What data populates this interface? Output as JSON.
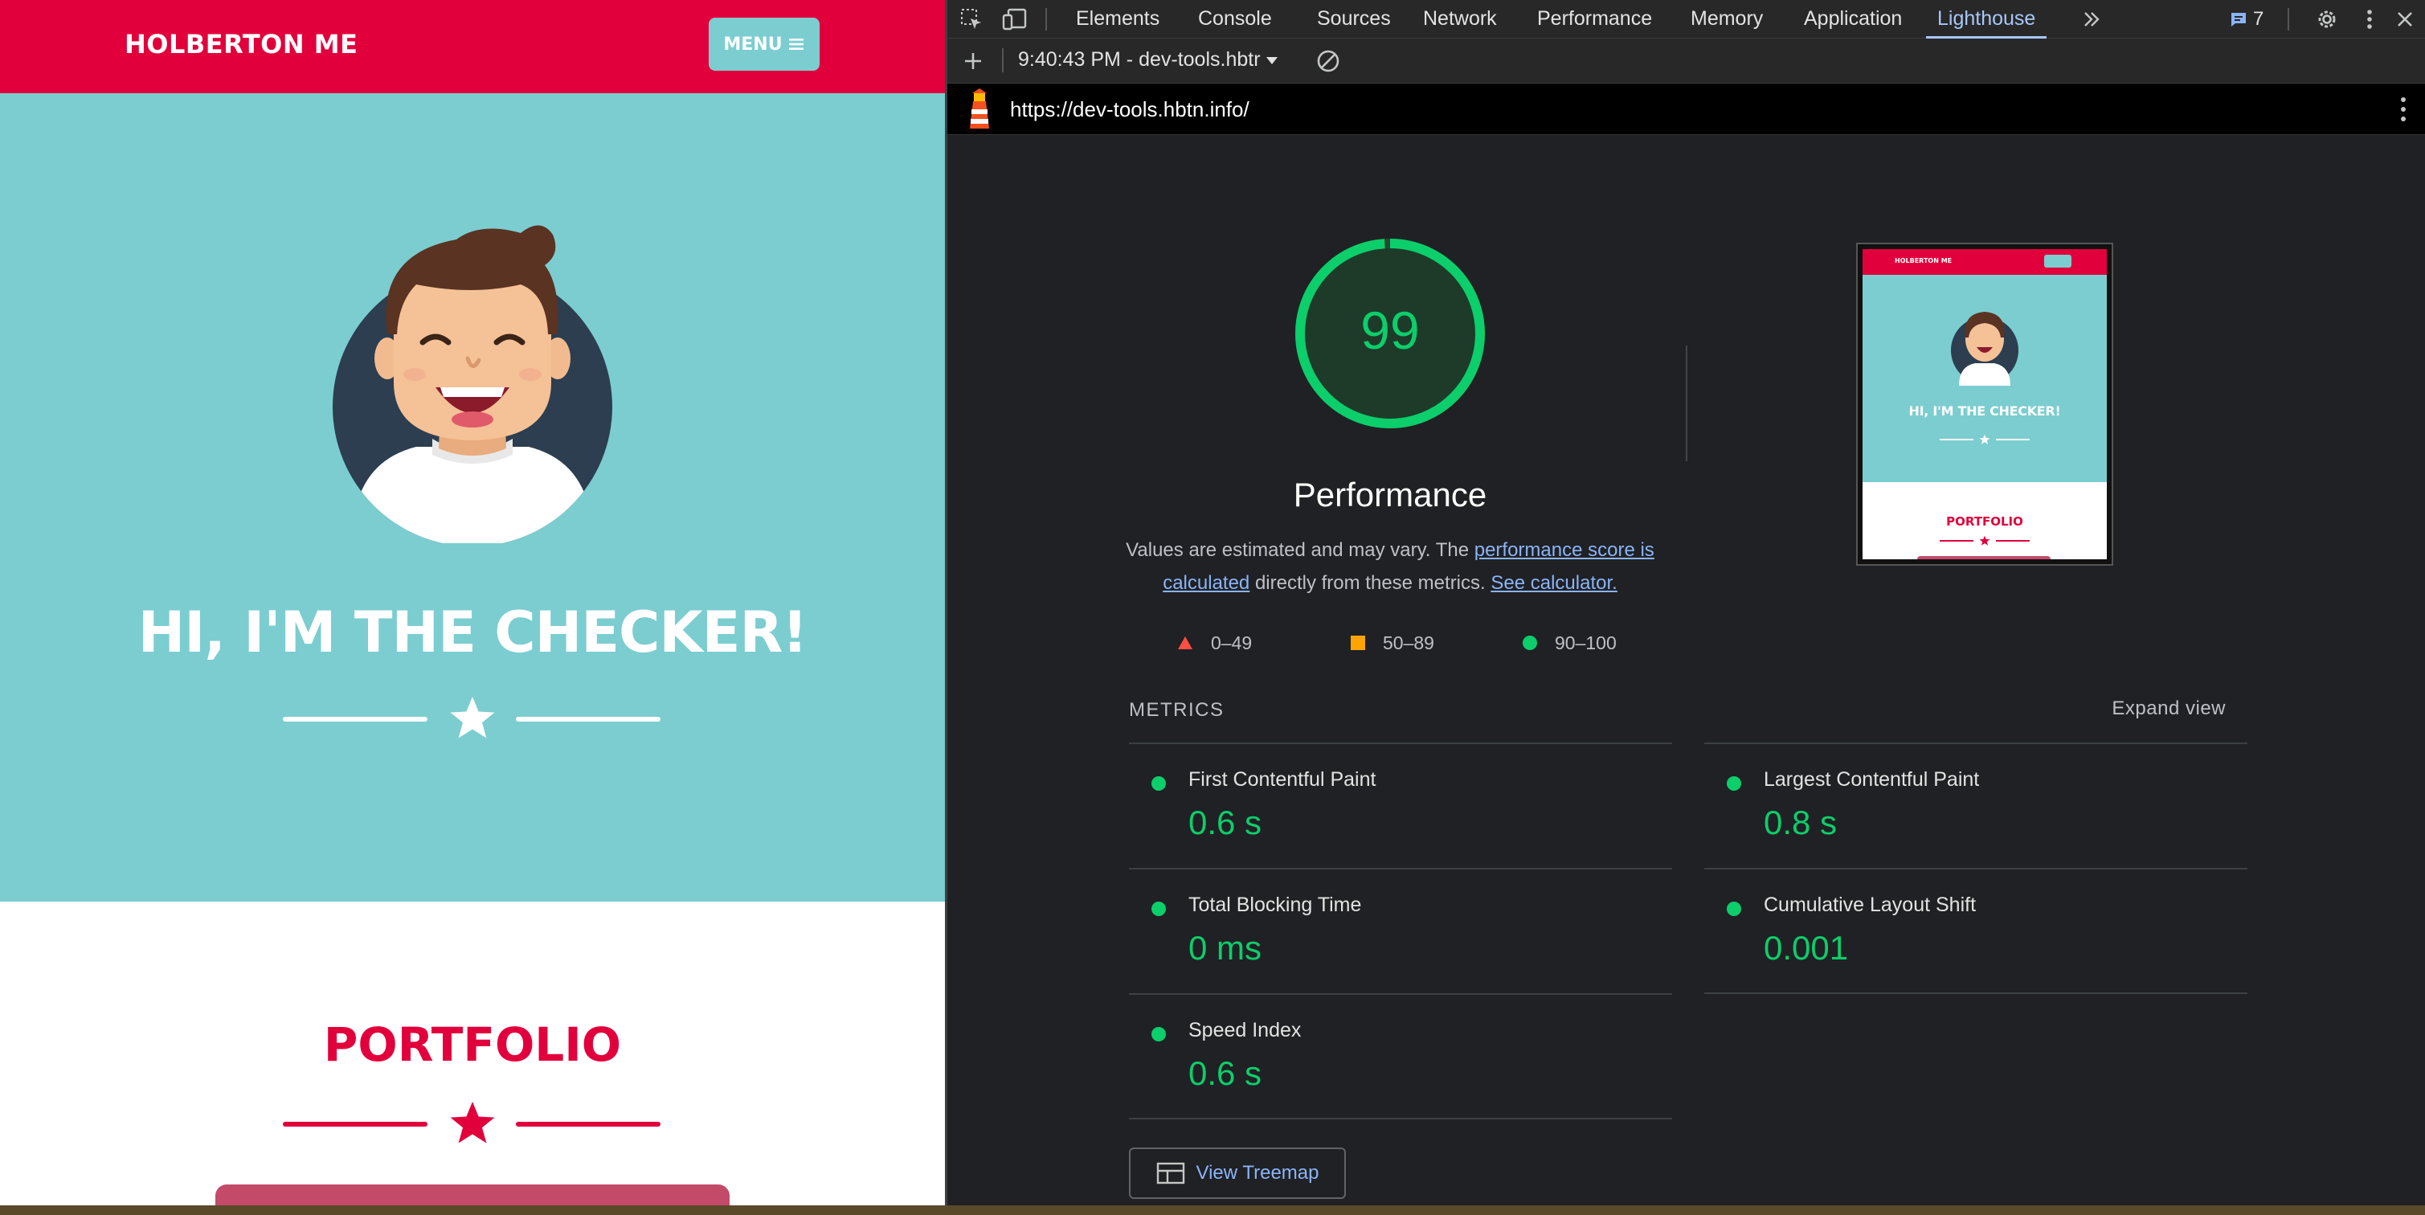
{
  "site": {
    "brand": "HOLBERTON ME",
    "menu_label": "MENU",
    "hero_title": "HI, I'M THE CHECKER!",
    "portfolio_title": "PORTFOLIO",
    "colors": {
      "primary": "#e1003c",
      "hero_bg": "#7bcdd0"
    }
  },
  "devtools": {
    "tabs": [
      {
        "label": "Elements"
      },
      {
        "label": "Console"
      },
      {
        "label": "Sources"
      },
      {
        "label": "Network"
      },
      {
        "label": "Performance"
      },
      {
        "label": "Memory"
      },
      {
        "label": "Application"
      },
      {
        "label": "Lighthouse",
        "active": true
      }
    ],
    "issues_count": "7",
    "toolbar": {
      "report_label": "9:40:43 PM - dev-tools.hbtr"
    },
    "url": "https://dev-tools.hbtn.info/"
  },
  "report": {
    "score": "99",
    "score_fraction": 0.99,
    "category": "Performance",
    "desc_prefix": "Values are estimated and may vary. The ",
    "desc_link1": "performance score is calculated",
    "desc_mid": " directly from these metrics. ",
    "desc_link2": "See calculator.",
    "legend": [
      {
        "range": "0–49",
        "shape": "triangle",
        "color": "#ff4e42"
      },
      {
        "range": "50–89",
        "shape": "square",
        "color": "#ffa400"
      },
      {
        "range": "90–100",
        "shape": "circle",
        "color": "#0cce6b"
      }
    ],
    "metrics_title": "METRICS",
    "expand_label": "Expand view",
    "metrics": [
      {
        "name": "First Contentful Paint",
        "value": "0.6 s"
      },
      {
        "name": "Largest Contentful Paint",
        "value": "0.8 s"
      },
      {
        "name": "Total Blocking Time",
        "value": "0 ms"
      },
      {
        "name": "Cumulative Layout Shift",
        "value": "0.001"
      },
      {
        "name": "Speed Index",
        "value": "0.6 s"
      }
    ],
    "treemap_label": "View Treemap",
    "good_color": "#0cce6b",
    "thumbnail": {
      "brand": "HOLBERTON ME",
      "title": "HI, I'M THE CHECKER!",
      "portfolio": "PORTFOLIO"
    }
  }
}
